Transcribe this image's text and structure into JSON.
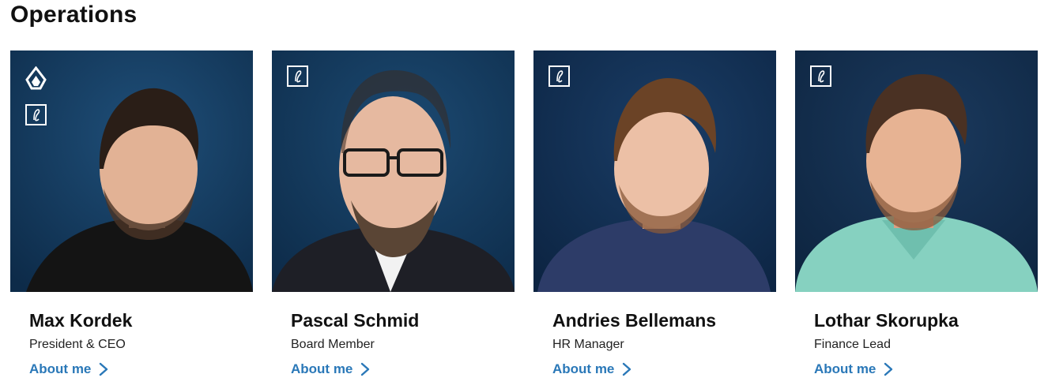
{
  "section": {
    "title": "Operations"
  },
  "colors": {
    "link": "#2a78b8",
    "photo_bg": "#0f2a48",
    "badge": "#ffffff"
  },
  "people": [
    {
      "name": "Max Kordek",
      "role": "President & CEO",
      "link_label": "About me",
      "shirt": "#141414",
      "hair": "#2a1e17",
      "has_logo": true
    },
    {
      "name": "Pascal Schmid",
      "role": "Board Member",
      "link_label": "About me",
      "shirt": "#1e1f26",
      "hair": "#3a2a20",
      "has_logo": false
    },
    {
      "name": "Andries Bellemans",
      "role": "HR Manager",
      "link_label": "About me",
      "shirt": "#2d3c68",
      "hair": "#6b4326",
      "has_logo": false
    },
    {
      "name": "Lothar Skorupka",
      "role": "Finance Lead",
      "link_label": "About me",
      "shirt": "#86d1c0",
      "hair": "#4a3123",
      "has_logo": false
    }
  ],
  "icons": {
    "badge": "script-l-badge-icon",
    "logo": "diamond-logo-icon",
    "chevron": "chevron-right-icon"
  }
}
